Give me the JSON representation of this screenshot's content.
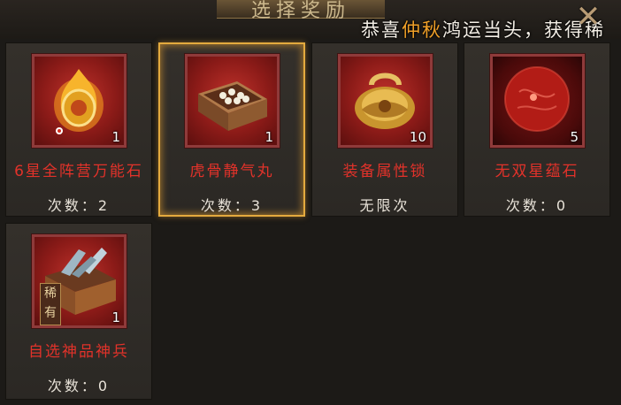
{
  "header": {
    "title": "选择奖励",
    "marquee_prefix": "恭喜",
    "marquee_highlight": "仲秋",
    "marquee_suffix": "鸿运当头，获得稀",
    "close_icon": "close-x-icon"
  },
  "rewards": [
    {
      "name": "6星全阵营万能石",
      "count_text": "次数：2",
      "quantity": "1",
      "icon": "golden-gem-icon",
      "selected": false
    },
    {
      "name": "虎骨静气丸",
      "count_text": "次数：3",
      "quantity": "1",
      "icon": "pill-box-icon",
      "selected": true
    },
    {
      "name": "装备属性锁",
      "count_text": "无限次",
      "quantity": "10",
      "icon": "golden-lock-icon",
      "selected": false
    },
    {
      "name": "无双星蕴石",
      "count_text": "次数：0",
      "quantity": "5",
      "icon": "red-orb-icon",
      "selected": false
    },
    {
      "name": "自选神品神兵",
      "count_text": "次数：0",
      "quantity": "1",
      "icon": "weapon-chest-icon",
      "selected": false,
      "tag": "稀有"
    }
  ],
  "colors": {
    "item_name": "#e2322a",
    "highlight": "#f0a028",
    "selected_border": "#e3aa3e"
  }
}
